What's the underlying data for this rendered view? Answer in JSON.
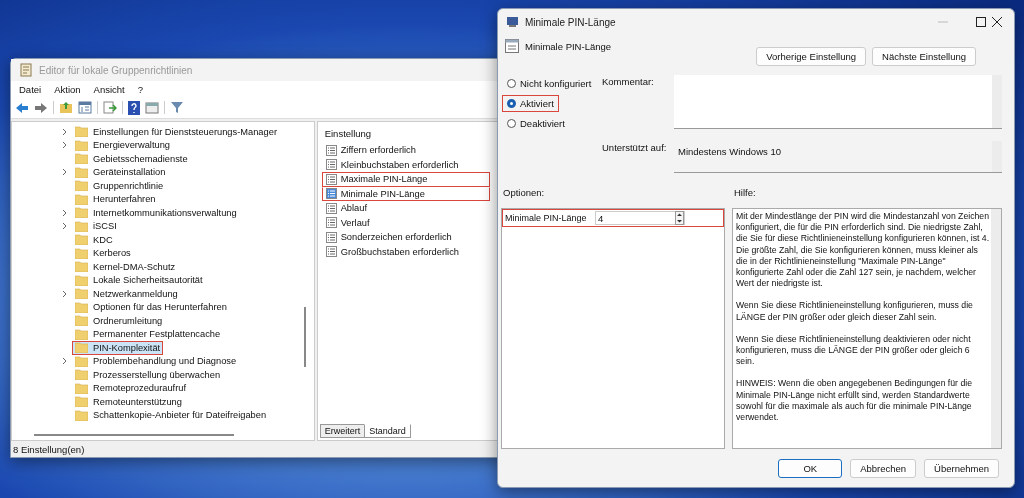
{
  "editor_window": {
    "title": "Editor für lokale Gruppenrichtlinien",
    "menu": [
      "Datei",
      "Aktion",
      "Ansicht",
      "?"
    ],
    "tree": [
      {
        "label": "Einstellungen für Dienststeuerungs-Manager",
        "expandable": true,
        "selected": false,
        "marked": false
      },
      {
        "label": "Energieverwaltung",
        "expandable": true,
        "selected": false,
        "marked": false
      },
      {
        "label": "Gebietsschemadienste",
        "expandable": false,
        "selected": false,
        "marked": false
      },
      {
        "label": "Geräteinstallation",
        "expandable": true,
        "selected": false,
        "marked": false
      },
      {
        "label": "Gruppenrichtlinie",
        "expandable": false,
        "selected": false,
        "marked": false
      },
      {
        "label": "Herunterfahren",
        "expandable": false,
        "selected": false,
        "marked": false
      },
      {
        "label": "Internetkommunikationsverwaltung",
        "expandable": true,
        "selected": false,
        "marked": false
      },
      {
        "label": "iSCSI",
        "expandable": true,
        "selected": false,
        "marked": false
      },
      {
        "label": "KDC",
        "expandable": false,
        "selected": false,
        "marked": false
      },
      {
        "label": "Kerberos",
        "expandable": false,
        "selected": false,
        "marked": false
      },
      {
        "label": "Kernel-DMA-Schutz",
        "expandable": false,
        "selected": false,
        "marked": false
      },
      {
        "label": "Lokale Sicherheitsautorität",
        "expandable": false,
        "selected": false,
        "marked": false
      },
      {
        "label": "Netzwerkanmeldung",
        "expandable": true,
        "selected": false,
        "marked": false
      },
      {
        "label": "Optionen für das Herunterfahren",
        "expandable": false,
        "selected": false,
        "marked": false
      },
      {
        "label": "Ordnerumleitung",
        "expandable": false,
        "selected": false,
        "marked": false
      },
      {
        "label": "Permanenter Festplattencache",
        "expandable": false,
        "selected": false,
        "marked": false
      },
      {
        "label": "PIN-Komplexität",
        "expandable": false,
        "selected": true,
        "marked": true
      },
      {
        "label": "Problembehandlung und Diagnose",
        "expandable": true,
        "selected": false,
        "marked": false
      },
      {
        "label": "Prozesserstellung überwachen",
        "expandable": false,
        "selected": false,
        "marked": false
      },
      {
        "label": "Remoteprozeduraufruf",
        "expandable": false,
        "selected": false,
        "marked": false
      },
      {
        "label": "Remoteunterstützung",
        "expandable": false,
        "selected": false,
        "marked": false
      },
      {
        "label": "Schattenkopie-Anbieter für Dateifreigaben",
        "expandable": false,
        "selected": false,
        "marked": false
      }
    ],
    "settings_list": {
      "heading": "Einstellung",
      "items": [
        {
          "label": "Ziffern erforderlich",
          "selected": false,
          "marked": false
        },
        {
          "label": "Kleinbuchstaben erforderlich",
          "selected": false,
          "marked": false
        },
        {
          "label": "Maximale PIN-Länge",
          "selected": false,
          "marked": true
        },
        {
          "label": "Minimale PIN-Länge",
          "selected": true,
          "marked": true
        },
        {
          "label": "Ablauf",
          "selected": false,
          "marked": false
        },
        {
          "label": "Verlauf",
          "selected": false,
          "marked": false
        },
        {
          "label": "Sonderzeichen erforderlich",
          "selected": false,
          "marked": false
        },
        {
          "label": "Großbuchstaben erforderlich",
          "selected": false,
          "marked": false
        }
      ]
    },
    "tabs": [
      {
        "label": "Erweitert",
        "selected": false
      },
      {
        "label": "Standard",
        "selected": true
      }
    ],
    "status_bar": "8 Einstellung(en)"
  },
  "dialog": {
    "title": "Minimale PIN-Länge",
    "setting_name": "Minimale PIN-Länge",
    "nav_buttons": [
      "Vorherige Einstellung",
      "Nächste Einstellung"
    ],
    "states": [
      {
        "label": "Nicht konfiguriert",
        "selected": false,
        "marked": false
      },
      {
        "label": "Aktiviert",
        "selected": true,
        "marked": true
      },
      {
        "label": "Deaktiviert",
        "selected": false,
        "marked": false
      }
    ],
    "comment_label": "Kommentar:",
    "supported_label": "Unterstützt auf:",
    "supported_value": "Mindestens Windows 10",
    "options_label": "Optionen:",
    "help_label": "Hilfe:",
    "option": {
      "label": "Minimale PIN-Länge",
      "value": "4",
      "marked": true
    },
    "help": [
      "Mit der Mindestlänge der PIN wird die Mindestanzahl von Zeichen konfiguriert, die für die PIN erforderlich sind.  Die niedrigste Zahl, die Sie für diese Richtlinieneinstellung konfigurieren können, ist 4.  Die größte Zahl, die Sie konfigurieren können, muss kleiner als die in der Richtlinieneinstellung \"Maximale PIN-Länge\" konfigurierte Zahl oder die Zahl 127 sein, je nachdem, welcher Wert der niedrigste ist.",
      "Wenn Sie diese Richtlinieneinstellung konfigurieren, muss die LÄNGE der PIN größer oder gleich dieser Zahl sein.",
      "Wenn Sie diese Richtlinieneinstellung deaktivieren oder nicht konfigurieren, muss die LÄNGE der PIN größer oder gleich 6 sein.",
      "HINWEIS: Wenn die oben angegebenen Bedingungen für die Minimale PIN-Länge nicht erfüllt sind, werden Standardwerte sowohl für die maximale als auch für die minimale PIN-Länge verwendet."
    ],
    "buttons": [
      {
        "label": "OK",
        "default": true
      },
      {
        "label": "Abbrechen",
        "default": false
      },
      {
        "label": "Übernehmen",
        "default": false
      }
    ]
  }
}
